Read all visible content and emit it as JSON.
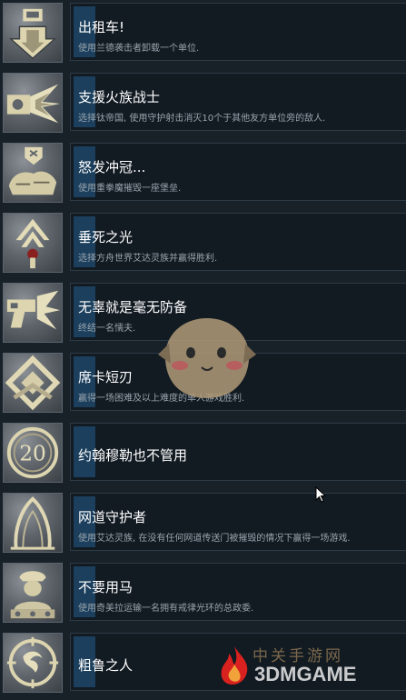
{
  "achievements": [
    {
      "title": "出租车!",
      "desc": "使用兰德袭击者卸载一个单位.",
      "icon": "drop-arrow-icon"
    },
    {
      "title": "支援火族战士",
      "desc": "选择钛帝国, 使用守护射击消灭10个于其他友方单位旁的敌人.",
      "icon": "gun-burst-icon"
    },
    {
      "title": "怒发冲冠...",
      "desc": "使用重拳魔摧毁一座堡垒.",
      "icon": "fist-icon"
    },
    {
      "title": "垂死之光",
      "desc": "选择方舟世界艾达灵族并赢得胜利.",
      "icon": "eldar-rune-icon"
    },
    {
      "title": "无辜就是毫无防备",
      "desc": "终结一名懦夫.",
      "icon": "pistol-icon"
    },
    {
      "title": "席卡短刃",
      "desc": "赢得一场困难及以上难度的单人游戏胜利.",
      "icon": "chevron-emblem-icon"
    },
    {
      "title": "约翰穆勒也不管用",
      "desc": "",
      "icon": "number-20-icon",
      "icon_text": "20"
    },
    {
      "title": "网道守护者",
      "desc": "使用艾达灵族, 在没有任何网道传送门被摧毁的情况下赢得一场游戏.",
      "icon": "webway-gate-icon"
    },
    {
      "title": "不要用马",
      "desc": "使用奇美拉运输一名拥有戒律光环的总政委.",
      "icon": "commissar-icon"
    },
    {
      "title": "粗鲁之人",
      "desc": "",
      "icon": "ork-glyph-icon"
    }
  ],
  "watermark": {
    "site": "中关手游网",
    "brand": "3DMGAME"
  },
  "colors": {
    "accent_bar": "#1b3f5c",
    "title": "#ffffff",
    "desc": "#9aa4ad",
    "icon_gold": "#d8cfa6"
  }
}
